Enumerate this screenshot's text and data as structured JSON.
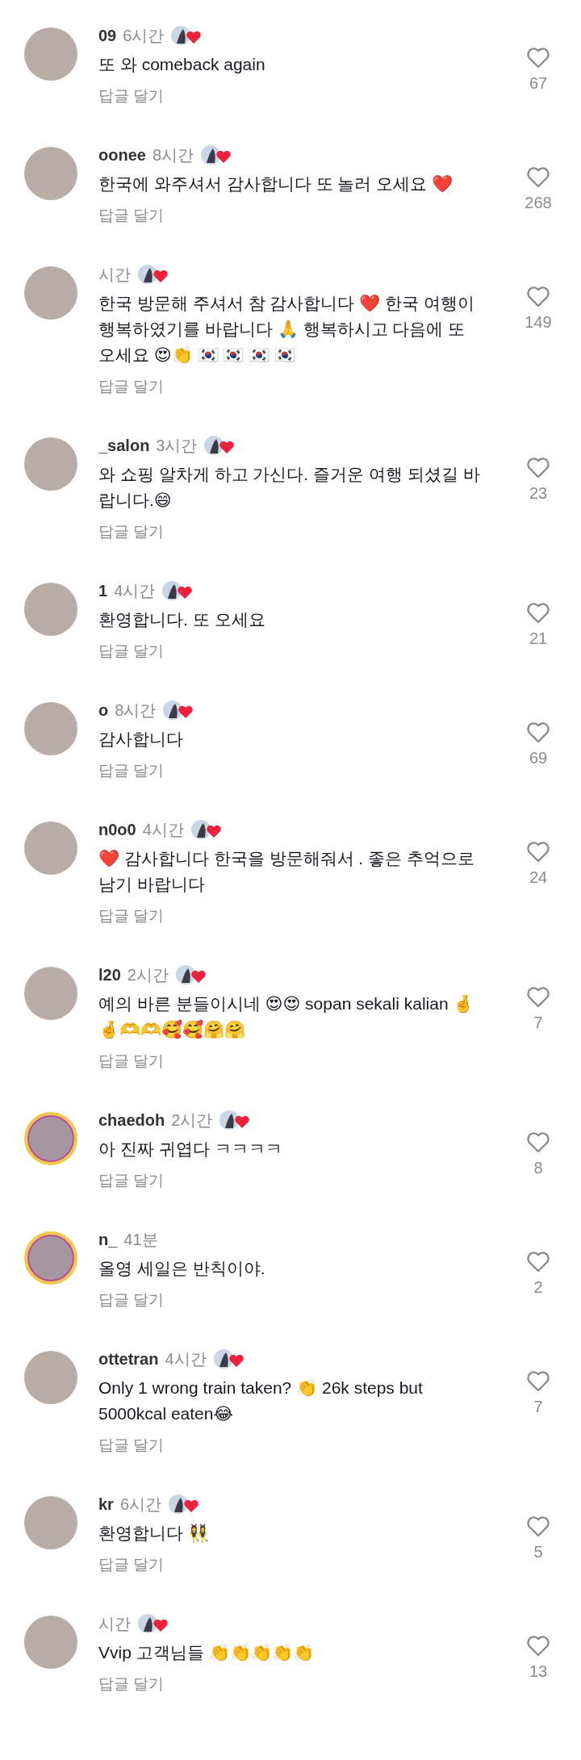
{
  "comments": [
    {
      "username": "09",
      "time": "6시간",
      "liked_by_creator": true,
      "story_ring": false,
      "text": "또 와 comeback again",
      "reply": "답글 달기",
      "likes": "67"
    },
    {
      "username": "oonee",
      "time": "8시간",
      "liked_by_creator": true,
      "story_ring": false,
      "text": "한국에 와주셔서 감사합니다 또 놀러 오세요 ❤️",
      "reply": "답글 달기",
      "likes": "268"
    },
    {
      "time": "시간",
      "liked_by_creator": true,
      "story_ring": false,
      "text": "한국 방문해 주셔서 참 감사합니다 ❤️ 한국 여행이 행복하였기를 바랍니다 🙏  행복하시고 다음에 또 오세요 😍👏 🇰🇷 🇰🇷 🇰🇷 🇰🇷",
      "reply": "답글 달기",
      "likes": "149"
    },
    {
      "username": "_salon",
      "time": "3시간",
      "liked_by_creator": true,
      "story_ring": false,
      "text": "와 쇼핑 알차게 하고 가신다.  즐거운 여행 되셨길 바랍니다.😄",
      "reply": "답글 달기",
      "likes": "23"
    },
    {
      "username": "1",
      "time": "4시간",
      "liked_by_creator": true,
      "story_ring": false,
      "text": "환영합니다. 또 오세요",
      "reply": "답글 달기",
      "likes": "21"
    },
    {
      "username": "o",
      "time": "8시간",
      "liked_by_creator": true,
      "story_ring": false,
      "text": "감사합니다",
      "reply": "답글 달기",
      "likes": "69"
    },
    {
      "username": "n0o0",
      "time": "4시간",
      "liked_by_creator": true,
      "story_ring": false,
      "text": "❤️ 감사합니다 한국을  방문해줘서 .  좋은 추억으로 남기 바랍니다",
      "reply": "답글 달기",
      "likes": "24"
    },
    {
      "username": "l20",
      "time": "2시간",
      "liked_by_creator": true,
      "story_ring": false,
      "text": "예의 바른 분들이시네 😍😍 sopan sekali kalian 🤞🤞🫶🫶🥰🥰🤗🤗",
      "reply": "답글 달기",
      "likes": "7"
    },
    {
      "username": "chaedoh",
      "time": "2시간",
      "liked_by_creator": true,
      "story_ring": true,
      "text": "아 진짜 귀엽다 ㅋㅋㅋㅋ",
      "reply": "답글 달기",
      "likes": "8"
    },
    {
      "username": "n_",
      "time": "41분",
      "liked_by_creator": false,
      "story_ring": true,
      "text": "올영 세일은 반칙이야.",
      "reply": "답글 달기",
      "likes": "2"
    },
    {
      "username": "ottetran",
      "time": "4시간",
      "liked_by_creator": true,
      "story_ring": false,
      "text": "Only 1 wrong train taken? 👏 26k steps but 5000kcal eaten😂",
      "reply": "답글 달기",
      "likes": "7"
    },
    {
      "username": "kr",
      "time": "6시간",
      "liked_by_creator": true,
      "story_ring": false,
      "text": "환영합니다 👯‍♀️",
      "reply": "답글 달기",
      "likes": "5"
    },
    {
      "time": "시간",
      "liked_by_creator": true,
      "story_ring": false,
      "text": "Vvip 고객님들 👏👏👏👏👏",
      "reply": "답글 달기",
      "likes": "13"
    }
  ]
}
